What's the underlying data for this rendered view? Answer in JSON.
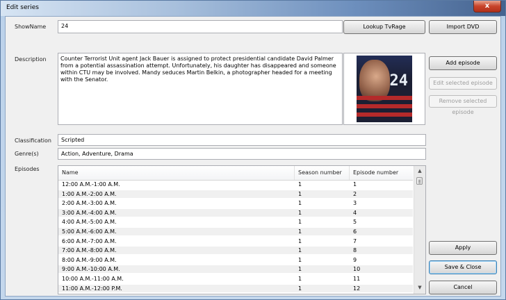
{
  "window": {
    "title": "Edit series",
    "close_glyph": "x"
  },
  "labels": {
    "showname": "ShowName",
    "description": "Description",
    "classification": "Classification",
    "genres": "Genre(s)",
    "episodes": "Episodes"
  },
  "fields": {
    "showname": "24",
    "description": "Counter Terrorist Unit agent Jack Bauer is assigned to protect presidential candidate David Palmer from a potential assassination attempt. Unfortunately, his daughter has disappeared and someone within CTU may be involved. Mandy seduces Martin Belkin, a photographer headed for a meeting with the Senator.",
    "classification": "Scripted",
    "genres": "Action, Adventure, Drama"
  },
  "poster": {
    "title_text": "24",
    "icon": "show-poster"
  },
  "buttons": {
    "lookup": "Lookup TvRage",
    "import_dvd": "Import DVD",
    "add_episode": "Add episode",
    "edit_selected": "Edit selected episode",
    "remove_selected": "Remove selected episode",
    "apply": "Apply",
    "save_close": "Save & Close",
    "cancel": "Cancel"
  },
  "episodes": {
    "columns": [
      "Name",
      "Season number",
      "Episode number"
    ],
    "rows": [
      {
        "name": "12:00 A.M.-1:00 A.M.",
        "season": "1",
        "episode": "1"
      },
      {
        "name": "1:00 A.M.-2:00 A.M.",
        "season": "1",
        "episode": "2"
      },
      {
        "name": "2:00 A.M.-3:00 A.M.",
        "season": "1",
        "episode": "3"
      },
      {
        "name": "3:00 A.M.-4:00 A.M.",
        "season": "1",
        "episode": "4"
      },
      {
        "name": "4:00 A.M.-5:00 A.M.",
        "season": "1",
        "episode": "5"
      },
      {
        "name": "5:00 A.M.-6:00 A.M.",
        "season": "1",
        "episode": "6"
      },
      {
        "name": "6:00 A.M.-7:00 A.M.",
        "season": "1",
        "episode": "7"
      },
      {
        "name": "7:00 A.M.-8:00 A.M.",
        "season": "1",
        "episode": "8"
      },
      {
        "name": "8:00 A.M.-9:00 A.M.",
        "season": "1",
        "episode": "9"
      },
      {
        "name": "9:00 A.M.-10:00 A.M.",
        "season": "1",
        "episode": "10"
      },
      {
        "name": "10:00 A.M.-11:00 A.M.",
        "season": "1",
        "episode": "11"
      },
      {
        "name": "11:00 A.M.-12:00 P.M.",
        "season": "1",
        "episode": "12"
      }
    ]
  },
  "scrollbar": {
    "up_glyph": "▲",
    "down_glyph": "▼"
  }
}
